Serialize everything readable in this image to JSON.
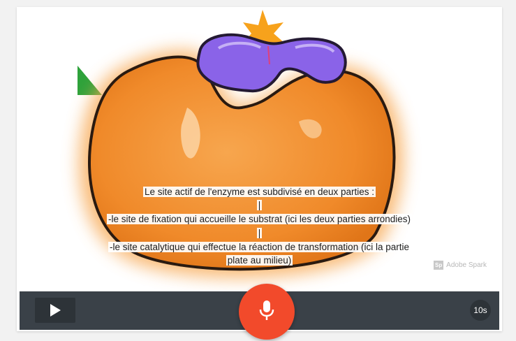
{
  "caption": {
    "line1": "Le site actif de l'enzyme est subdivisé en deux parties :",
    "sep1": "|",
    "line2": "-le site de fixation qui accueille le substrat (ici les deux parties arrondies)",
    "sep2": "|",
    "line3": "-le site catalytique qui effectue la réaction de transformation (ici la partie",
    "line4": "plate au milieu)"
  },
  "watermark": {
    "logo": "Sp",
    "text": "Adobe Spark"
  },
  "controls": {
    "play_icon": "play-icon",
    "mic_icon": "microphone-icon",
    "timer": "10s"
  },
  "colors": {
    "enzyme": "#f39135",
    "substrate": "#8a63e8",
    "star": "#f7a21c",
    "triangle": "#2ea23b",
    "mic_button": "#f24a2b",
    "control_bar": "#3a4148"
  }
}
